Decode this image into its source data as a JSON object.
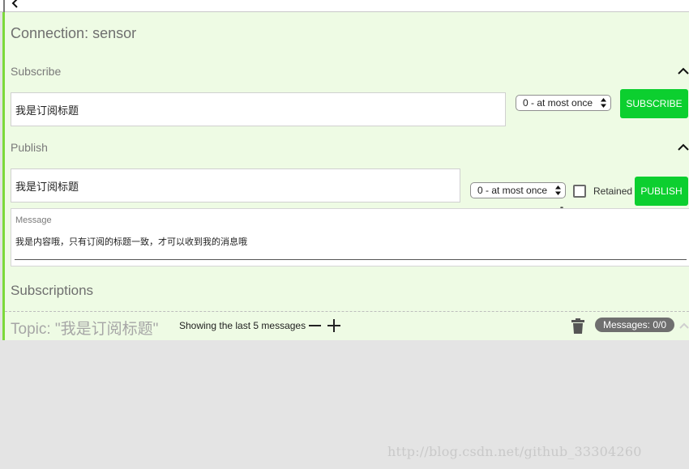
{
  "connection": {
    "title": "Connection: sensor"
  },
  "subscribe": {
    "section_label": "Subscribe",
    "topic_value": "我是订阅标题",
    "qos_selected": "0 - at most once",
    "button_label": "SUBSCRIBE"
  },
  "publish": {
    "section_label": "Publish",
    "topic_value": "我是订阅标题",
    "qos_selected": "0 - at most once",
    "retained_label": "Retained",
    "retained_checked": false,
    "button_label": "PUBLISH",
    "message_label": "Message",
    "message_value": "我是内容哦，只有订阅的标题一致，才可以收到我的消息哦"
  },
  "subscriptions": {
    "title": "Subscriptions",
    "topic_title": "Topic: \"我是订阅标题\"",
    "showing_text": "Showing the last 5 messages",
    "messages_badge": "Messages: 0/0"
  },
  "watermark": "http://blog.csdn.net/github_33304260",
  "colors": {
    "accent_green": "#0ccf2f",
    "panel_bg": "#eefbe4",
    "panel_border": "#7cd93a",
    "badge_bg": "#6f6f6f"
  },
  "icons": [
    "back-arrow-icon",
    "chevron-up-icon",
    "select-arrows-icon",
    "minus-icon",
    "plus-icon",
    "trash-icon",
    "pointer-cursor-icon"
  ]
}
